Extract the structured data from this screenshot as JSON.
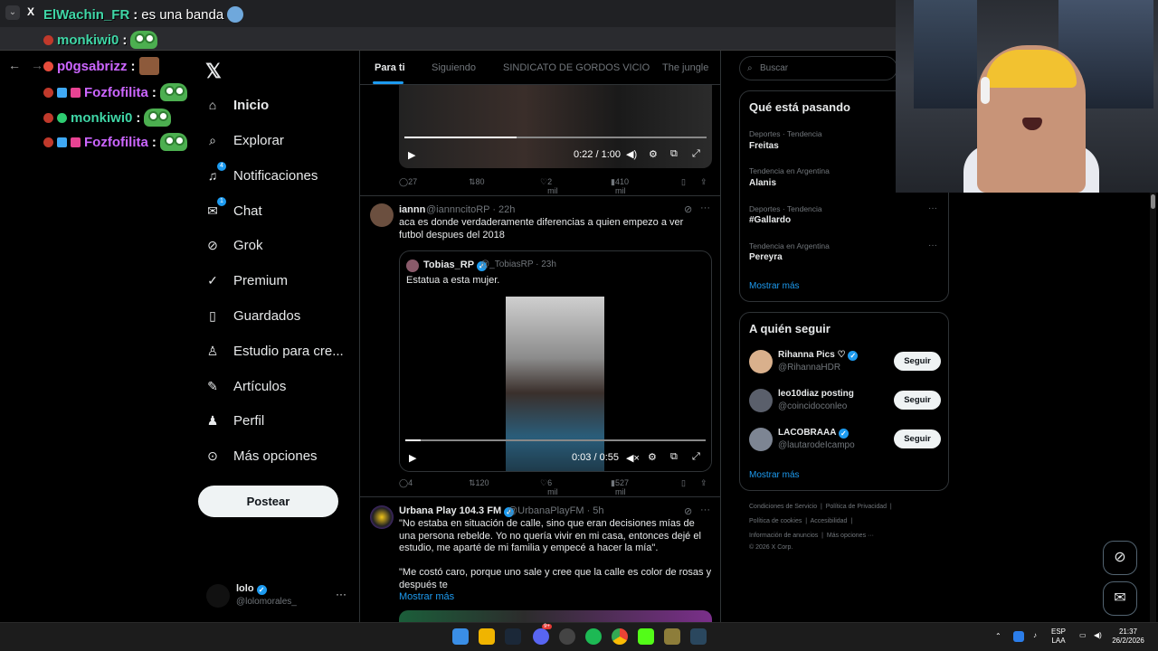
{
  "browser": {
    "tab_control": "⌄",
    "tab_favicon": "X"
  },
  "chat": [
    {
      "user": "ElWachin_FR",
      "message": " es una banda",
      "color": "#3fd6a6"
    },
    {
      "user": "monkiwi0",
      "message": "",
      "color": "#3fd6a6"
    },
    {
      "user": "p0gsabrizz",
      "message": "",
      "color": "#cc66ff"
    },
    {
      "user": "Fozfofilita",
      "message": "",
      "color": "#cc66ff"
    },
    {
      "user": "monkiwi0",
      "message": "",
      "color": "#3fd6a6"
    },
    {
      "user": "Fozfofilita",
      "message": "",
      "color": "#cc66ff"
    }
  ],
  "nav": {
    "logo": "𝕏",
    "items": [
      {
        "label": "Inicio",
        "icon": "home-icon"
      },
      {
        "label": "Explorar",
        "icon": "search-icon"
      },
      {
        "label": "Notificaciones",
        "icon": "bell-icon"
      },
      {
        "label": "Chat",
        "icon": "mail-icon"
      },
      {
        "label": "Grok",
        "icon": "grok-icon"
      },
      {
        "label": "Premium",
        "icon": "premium-icon"
      },
      {
        "label": "Guardados",
        "icon": "bookmark-icon"
      },
      {
        "label": "Estudio para cre...",
        "icon": "studio-icon"
      },
      {
        "label": "Artículos",
        "icon": "article-icon"
      },
      {
        "label": "Perfil",
        "icon": "person-icon"
      },
      {
        "label": "Más opciones",
        "icon": "more-icon"
      }
    ],
    "notif_badge": "4",
    "chat_badge": "1",
    "post_label": "Postear",
    "me_name": "lolo",
    "me_handle": "@lolomorales_",
    "me_more": "···"
  },
  "timeline": {
    "tabs": [
      "Para ti",
      "Siguiendo",
      "SINDICATO DE GORDOS VICIO",
      "The jungle"
    ],
    "post1": {
      "time": "0:22 / 1:00",
      "progress": 0.37,
      "replies": "27",
      "reposts": "80",
      "likes": "2 mil",
      "views": "410 mil"
    },
    "post2": {
      "name": "iannn",
      "handle": "@iannncitoRP · 22h",
      "text": "aca es donde verdaderamente diferencias a quien empezo a ver futbol despues del 2018",
      "quote": {
        "name": "Tobias_RP",
        "handle": "@_TobiasRP · 23h",
        "text": "Estatua a esta mujer.",
        "time": "0:03 / 0:55",
        "progress": 0.05
      },
      "replies": "4",
      "reposts": "120",
      "likes": "6 mil",
      "views": "527 mil"
    },
    "post3": {
      "name": "Urbana Play 104.3 FM",
      "handle": "@UrbanaPlayFM · 5h",
      "text1": "\"No estaba en situación de calle, sino que eran decisiones mías de una persona rebelde. Yo no quería vivir en mi casa, entonces dejé el estudio, me aparté de mi familia y empecé a hacer la mía\".",
      "text2": "\"Me costó caro, porque uno sale y cree que la calle es color de rosas y después te",
      "more": "Mostrar más"
    }
  },
  "right": {
    "search_placeholder": "Buscar",
    "trending_title": "Qué está pasando",
    "trends": [
      {
        "meta": "Deportes · Tendencia",
        "title": "Freitas"
      },
      {
        "meta": "Tendencia en Argentina",
        "title": "Alanis"
      },
      {
        "meta": "Deportes · Tendencia",
        "title": "#Gallardo"
      },
      {
        "meta": "Tendencia en Argentina",
        "title": "Pereyra"
      }
    ],
    "trends_more": "Mostrar más",
    "follow_title": "A quién seguir",
    "follow": [
      {
        "name": "Rihanna Pics ♡",
        "handle": "@RihannaHDR",
        "btn": "Seguir"
      },
      {
        "name": "leo10diaz posting",
        "handle": "@coincidoconleo",
        "btn": "Seguir"
      },
      {
        "name": "LACOBRAAA",
        "handle": "@lautarodeIcampo",
        "btn": "Seguir"
      }
    ],
    "follow_more": "Mostrar más",
    "footer": {
      "line1a": "Condiciones de Servicio",
      "line1b": "Política de Privacidad",
      "line2a": "Política de cookies",
      "line2b": "Accesibilidad",
      "line3a": "Información de anuncios",
      "line3b": "Más opciones ···",
      "line4": "© 2026 X Corp."
    }
  },
  "taskbar": {
    "lang1": "ESP",
    "lang2": "LAA",
    "time": "21:37",
    "date": "26/2/2026",
    "discord_badge": "9+"
  },
  "colors": {
    "accent": "#1d9bf0",
    "background": "#000000"
  }
}
